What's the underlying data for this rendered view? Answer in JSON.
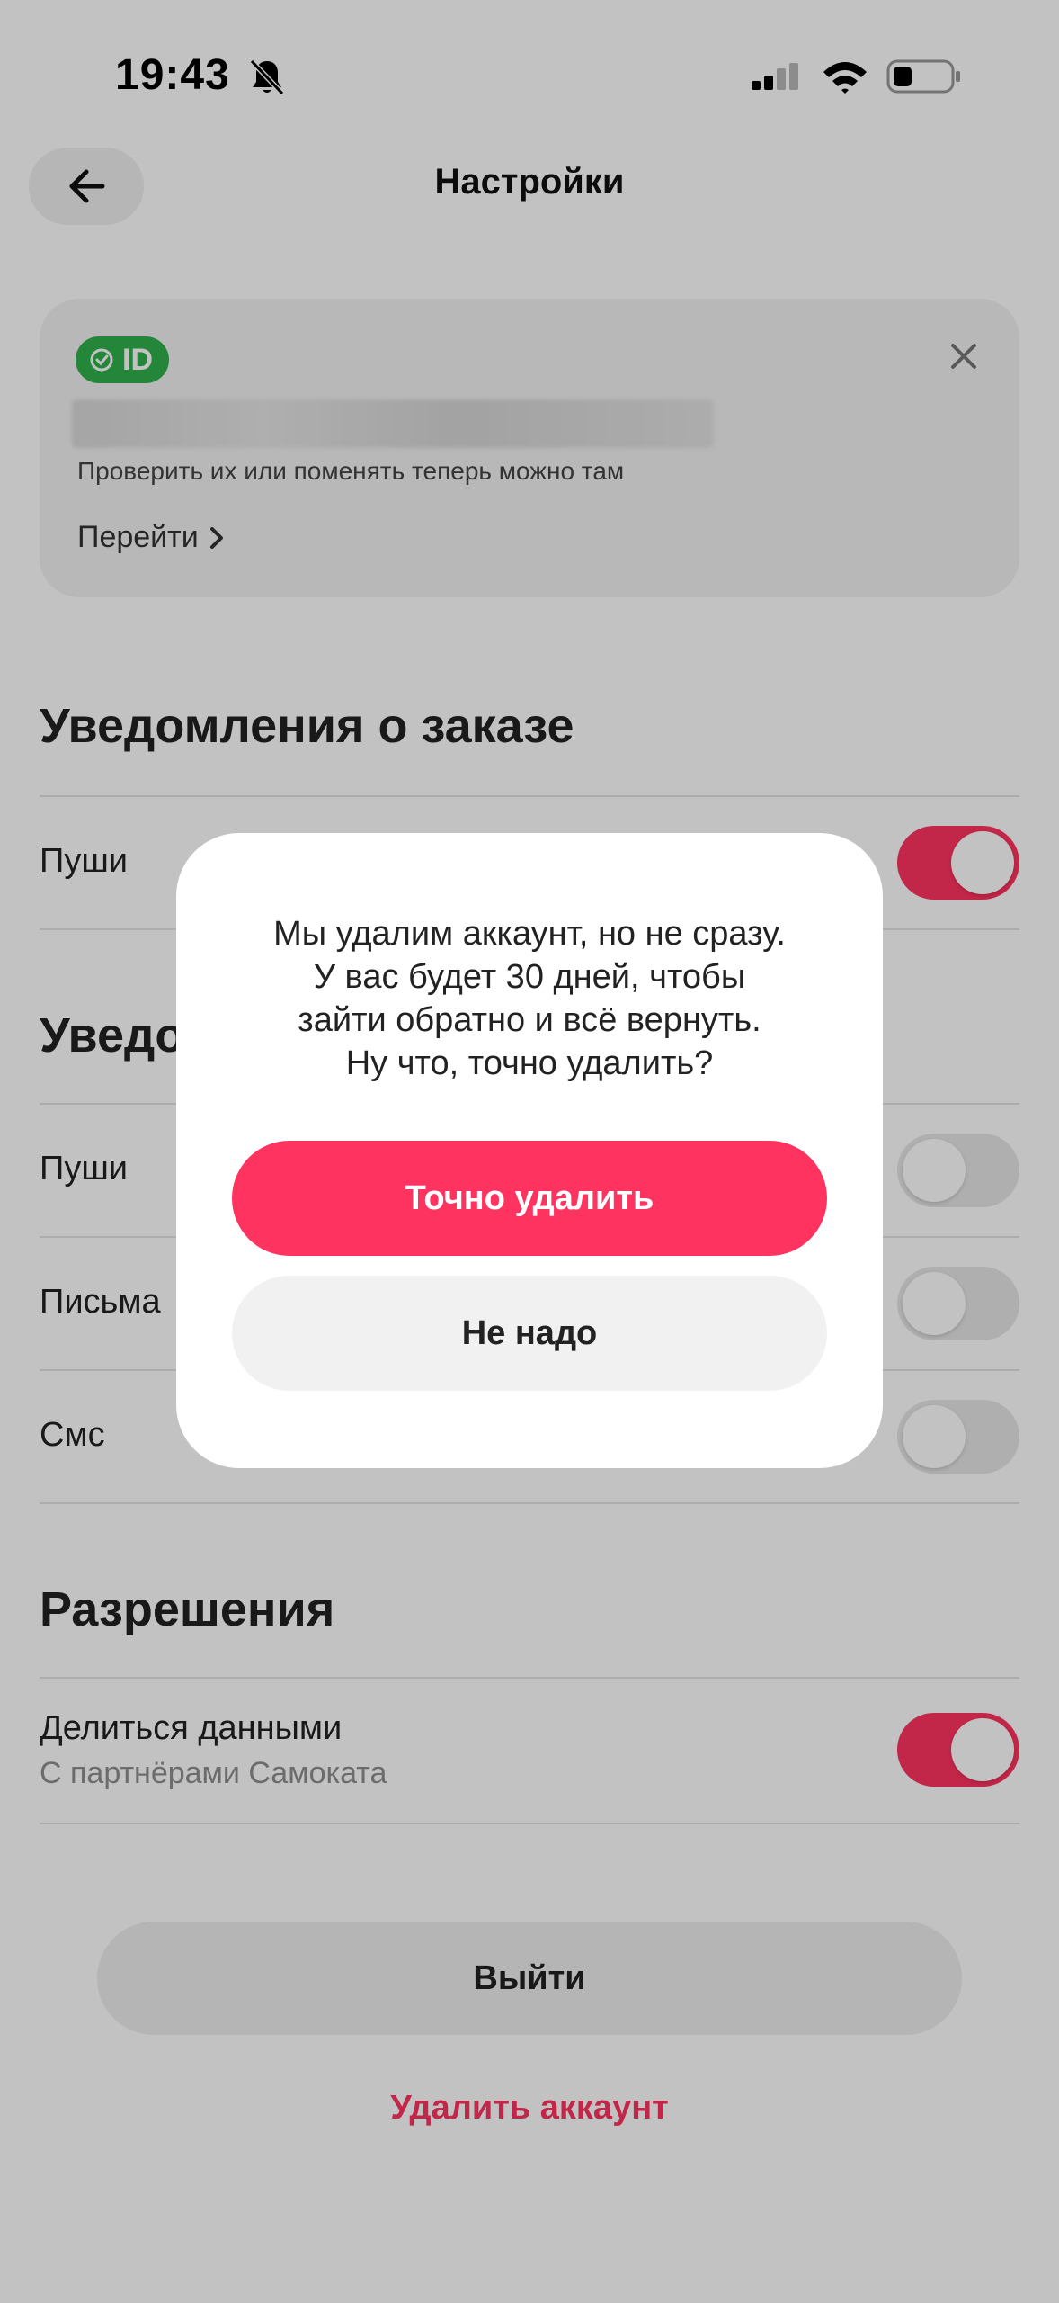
{
  "status_bar": {
    "time": "19:43"
  },
  "header": {
    "title": "Настройки"
  },
  "id_card": {
    "badge": "ID",
    "description": "Проверить их или поменять теперь можно там",
    "link_label": "Перейти"
  },
  "order_notifications": {
    "title": "Уведомления о заказе",
    "rows": [
      {
        "label": "Пуши",
        "enabled": true
      }
    ]
  },
  "promo_notifications": {
    "title": "Уведо",
    "rows": [
      {
        "label": "Пуши",
        "enabled": false
      },
      {
        "label": "Письма",
        "enabled": false
      },
      {
        "label": "Смс",
        "enabled": false
      }
    ]
  },
  "permissions": {
    "title": "Разрешения",
    "rows": [
      {
        "label": "Делиться данными",
        "sublabel": "С партнёрами Самоката",
        "enabled": true
      }
    ]
  },
  "actions": {
    "logout_label": "Выйти",
    "delete_label": "Удалить аккаунт"
  },
  "modal": {
    "lines": [
      "Мы удалим аккаунт, но не сразу.",
      "У вас будет 30 дней, чтобы",
      "зайти обратно и всё вернуть.",
      "Ну что, точно удалить?"
    ],
    "confirm_label": "Точно удалить",
    "cancel_label": "Не надо"
  },
  "colors": {
    "accent": "#ff335f",
    "id_badge": "#2fb04c",
    "overlay": "rgba(0,0,0,0.24)"
  }
}
